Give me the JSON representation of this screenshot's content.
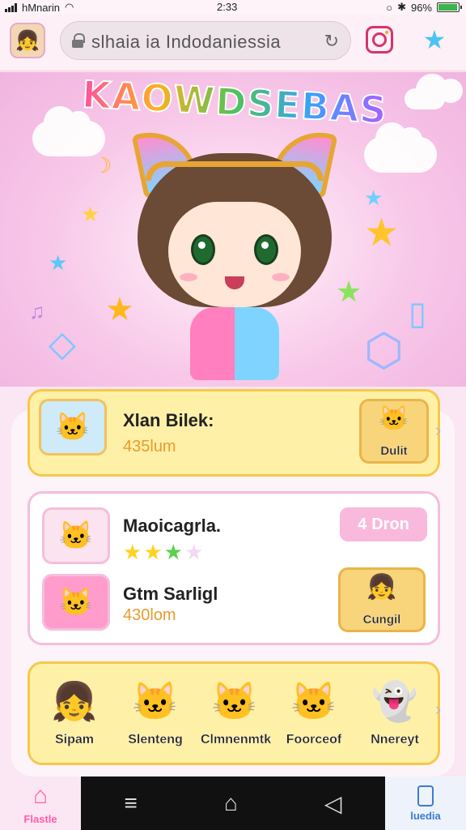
{
  "status_bar": {
    "carrier": "hMnarin",
    "time": "2:33",
    "battery_percent": "96%"
  },
  "browser": {
    "url": "slhaia ia Indodaniessia",
    "accent_color": "#d6336c"
  },
  "hero": {
    "title": "KAOWDSEBAS"
  },
  "featured": {
    "title": "Xlan Bilek:",
    "subtitle": "435lum",
    "tag_label": "Dulit"
  },
  "list_card": {
    "item1": {
      "title": "Maoicagrla.",
      "rating_stars": 4,
      "button_label": "Dron",
      "button_icon": "4"
    },
    "item2": {
      "title": "Gtm Sarligl",
      "subtitle": "430lom",
      "tag_label": "Cungil"
    }
  },
  "characters": [
    {
      "name": "Sipam"
    },
    {
      "name": "Slenteng"
    },
    {
      "name": "Clmnenmtk"
    },
    {
      "name": "Foorceof"
    },
    {
      "name": "Nnereyt"
    }
  ],
  "bottom_nav": {
    "left_label": "Flastle",
    "right_label": "luedia"
  },
  "colors": {
    "pink": "#ff5ea8",
    "yellow_card": "#fff0a8",
    "hero_pink": "#f1b4df"
  }
}
